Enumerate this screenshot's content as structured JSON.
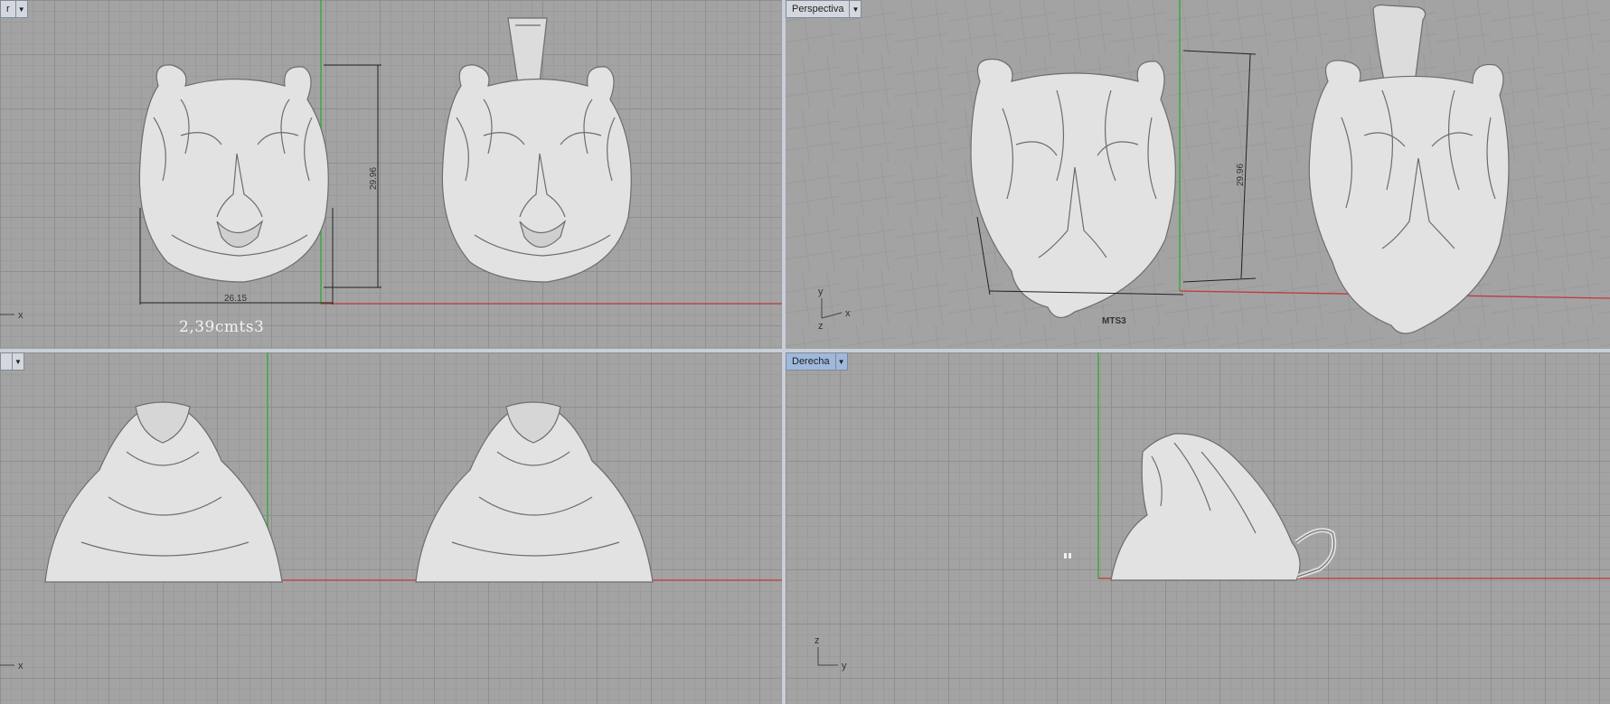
{
  "viewports": {
    "top_left": {
      "tab_label": "r"
    },
    "top_right": {
      "tab_label": "Perspectiva"
    },
    "bottom_left": {
      "tab_label": ""
    },
    "bottom_right": {
      "tab_label": "Derecha"
    }
  },
  "dimensions": {
    "width": "26.15",
    "height_front": "29.96",
    "height_persp": "29.96"
  },
  "watermark": "2,39cmts3",
  "engraving": "MTS3",
  "axes": {
    "x": "x",
    "y": "y",
    "z": "z"
  },
  "colors": {
    "x_axis": "#c23a3a",
    "y_axis": "#2eaa2e",
    "model": "#e6e6e6",
    "grid_bg": "#a3a3a3"
  },
  "icons": [
    "dropdown-arrow-icon",
    "tiger-pendant-model",
    "axis-gizmo-icon"
  ]
}
